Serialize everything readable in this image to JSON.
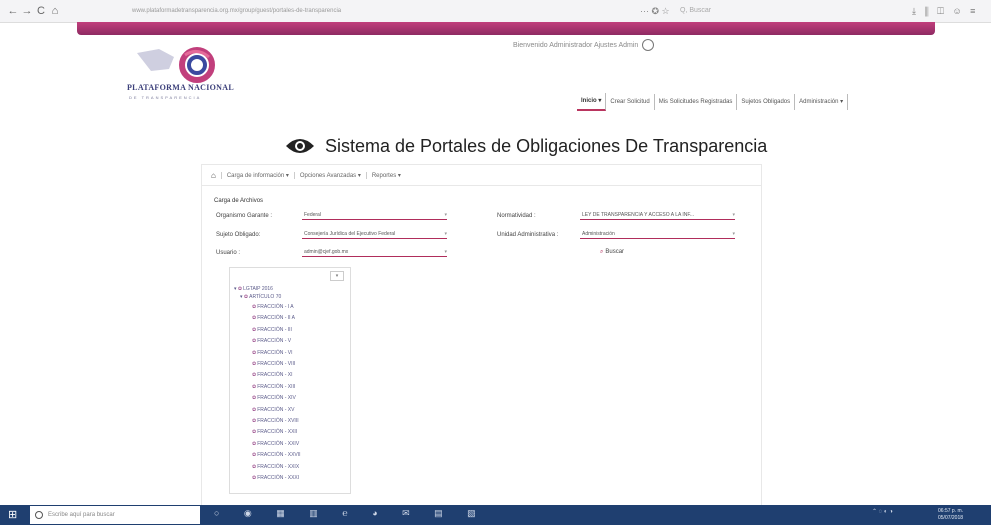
{
  "browser": {
    "back": "←",
    "forward": "→",
    "reload": "C",
    "home": "⌂",
    "url": "www.plataformadetransparencia.org.mx/group/guest/portales-de-transparencia",
    "page_actions": "··· ✪ ☆",
    "search_placeholder": "Q, Buscar",
    "right_icons": "⤓ ⫼ ◫ ☺ ≡"
  },
  "header": {
    "logo_title": "PLATAFORMA NACIONAL",
    "logo_subtitle": "DE TRANSPARENCIA",
    "user_status": "Bienvenido Administrador Ajustes Admin",
    "menu": [
      {
        "label": "Inicio ▾"
      },
      {
        "label": "Crear Solicitud"
      },
      {
        "label": "Mis Solicitudes Registradas"
      },
      {
        "label": "Sujetos Obligados"
      },
      {
        "label": "Administración ▾"
      }
    ]
  },
  "page": {
    "title": "Sistema de Portales de Obligaciones De Transparencia"
  },
  "subnav": {
    "items": [
      {
        "label": "Carga de información ▾"
      },
      {
        "label": "Opciones Avanzadas ▾"
      },
      {
        "label": "Reportes ▾"
      }
    ]
  },
  "form": {
    "section_label": "Carga de Archivos",
    "organismo_label": "Organismo Garante :",
    "organismo_value": "Federal",
    "normatividad_label": "Normatividad :",
    "normatividad_value": "LEY DE TRANSPARENCIA Y ACCESO A LA INF...",
    "sujeto_label": "Sujeto Obligado:",
    "sujeto_value": "Consejería Jurídica del Ejecutivo Federal",
    "unidad_label": "Unidad Administrativa :",
    "unidad_value": "Administración",
    "usuario_label": "Usuario :",
    "usuario_value": "admin@cjef.gob.mx",
    "buscar_label": "Buscar",
    "caret": "▾"
  },
  "tree": {
    "filter_symbol": "▾",
    "root": "LGTAIP 2016",
    "child": "ARTÍCULO 70",
    "leaves": [
      "FRACCIÓN - I A",
      "FRACCIÓN - II A",
      "FRACCIÓN - III",
      "FRACCIÓN - V",
      "FRACCIÓN - VI",
      "FRACCIÓN - VIII",
      "FRACCIÓN - XI",
      "FRACCIÓN - XIII",
      "FRACCIÓN - XIV",
      "FRACCIÓN - XV",
      "FRACCIÓN - XVIII",
      "FRACCIÓN - XXII",
      "FRACCIÓN - XXIV",
      "FRACCIÓN - XXVII",
      "FRACCIÓN - XXIX",
      "FRACCIÓN - XXXI"
    ]
  },
  "taskbar": {
    "start": "⊞",
    "search_placeholder": "Escribe aquí para buscar",
    "apps": "○ ◉ ▦ ▥ ℮ ◕ ✉ ▤ ▧",
    "tray": "⌃ ◌ ◐ ◑",
    "time": "06:57 p. m.",
    "date": "05/07/2018"
  },
  "colors": {
    "accent": "#b02d5b",
    "strip": "#c13f7c",
    "taskbar": "#1f3f70",
    "logo_text": "#3b3f7a"
  }
}
